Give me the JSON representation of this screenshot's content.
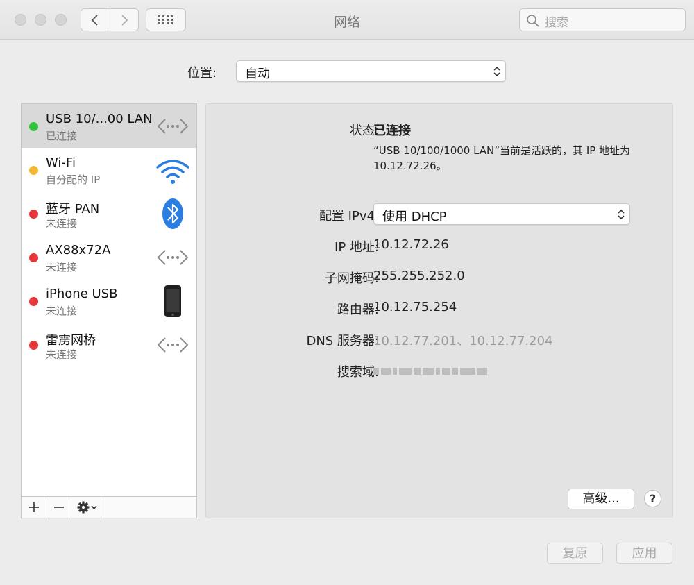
{
  "window": {
    "title": "网络"
  },
  "search": {
    "placeholder": "搜索"
  },
  "location": {
    "label": "位置:",
    "value": "自动"
  },
  "services": [
    {
      "name": "USB 10/...00 LAN",
      "status": "已连接",
      "dot_color": "#2fc23a",
      "icon": "ethernet-icon",
      "selected": true
    },
    {
      "name": "Wi-Fi",
      "status": "自分配的 IP",
      "dot_color": "#f5b731",
      "icon": "wifi-icon",
      "selected": false
    },
    {
      "name": "蓝牙 PAN",
      "status": "未连接",
      "dot_color": "#e7373a",
      "icon": "bluetooth-icon",
      "selected": false
    },
    {
      "name": "AX88x72A",
      "status": "未连接",
      "dot_color": "#e7373a",
      "icon": "ethernet-icon",
      "selected": false
    },
    {
      "name": "iPhone USB",
      "status": "未连接",
      "dot_color": "#e7373a",
      "icon": "iphone-icon",
      "selected": false
    },
    {
      "name": "雷雳网桥",
      "status": "未连接",
      "dot_color": "#e7373a",
      "icon": "ethernet-icon",
      "selected": false
    }
  ],
  "toolbar": {
    "add": "+",
    "remove": "−"
  },
  "detail": {
    "status_label": "状态:",
    "status_value": "已连接",
    "status_desc": "“USB 10/100/1000 LAN”当前是活跃的，其 IP 地址为 10.12.72.26。",
    "ipv4_label": "配置 IPv4:",
    "ipv4_value": "使用 DHCP",
    "ip_label": "IP 地址:",
    "ip_value": "10.12.72.26",
    "subnet_label": "子网掩码:",
    "subnet_value": "255.255.252.0",
    "router_label": "路由器:",
    "router_value": "10.12.75.254",
    "dns_label": "DNS 服务器:",
    "dns_value": "10.12.77.201、10.12.77.204",
    "search_domain_label": "搜索域:"
  },
  "buttons": {
    "advanced": "高级...",
    "help": "?",
    "revert": "复原",
    "apply": "应用"
  },
  "colors": {
    "accent_blue": "#2a7de1",
    "selected_row": "#d9d9d9"
  }
}
